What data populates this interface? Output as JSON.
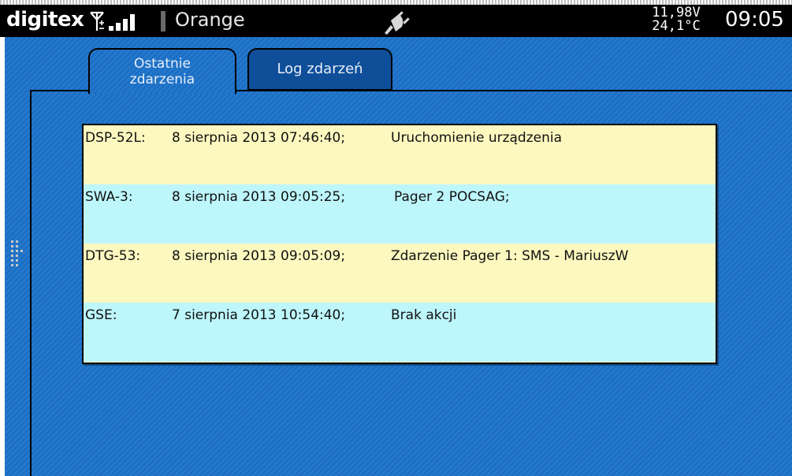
{
  "statusbar": {
    "brand": "digitex",
    "carrier": "Orange",
    "voltage": "11,98V",
    "temperature": "24,1°C",
    "time": "09:05",
    "signal_bars": 4
  },
  "tabs": [
    {
      "label_line1": "Ostatnie",
      "label_line2": "zdarzenia",
      "active": true
    },
    {
      "label": "Log zdarzeń",
      "active": false
    }
  ],
  "events": [
    {
      "source": "DSP-52L:",
      "date": "8 sierpnia 2013 07:46:40;",
      "description": "Uruchomienie urządzenia"
    },
    {
      "source": "SWA-3:",
      "date": "8 sierpnia 2013 09:05:25;",
      "description": "Pager 2 POCSAG;"
    },
    {
      "source": "DTG-53:",
      "date": "8 sierpnia 2013 09:05:09;",
      "description": "Zdarzenie Pager 1: SMS - MariuszW"
    },
    {
      "source": "GSE:",
      "date": "7 sierpnia 2013 10:54:40;",
      "description": "Brak akcji"
    }
  ],
  "colors": {
    "background_blue": "#1a6fc6",
    "row_yellow": "#fdf8bf",
    "row_cyan": "#bdf6fb",
    "statusbar": "#000000"
  },
  "icons": {
    "antenna": "antenna-icon",
    "power_plug": "power-plug-icon",
    "drag_handle": "drag-handle-icon"
  }
}
